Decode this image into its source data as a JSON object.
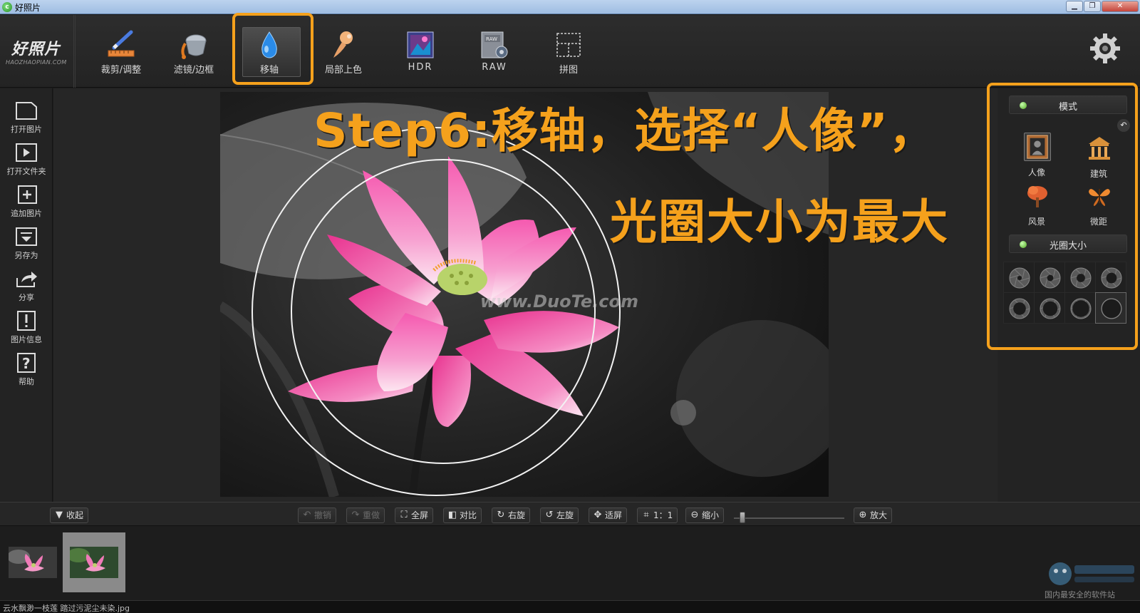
{
  "window": {
    "title": "好照片",
    "app_icon": "green-leaf-icon",
    "controls": [
      "minimize",
      "maximize",
      "close"
    ]
  },
  "logo": {
    "main": "好照片",
    "sub": "HAOZHAOPIAN.COM"
  },
  "toolbar": {
    "tools": [
      {
        "label": "裁剪/调整",
        "icon": "crop-ruler-icon"
      },
      {
        "label": "滤镜/边框",
        "icon": "paint-bucket-icon"
      },
      {
        "label": "移轴",
        "icon": "water-drop-icon",
        "selected": true
      },
      {
        "label": "局部上色",
        "icon": "paint-brush-icon"
      },
      {
        "label": "HDR",
        "icon": "hdr-image-icon"
      },
      {
        "label": "RAW",
        "icon": "raw-file-icon"
      },
      {
        "label": "拼图",
        "icon": "collage-grid-icon"
      }
    ],
    "settings_icon": "gear-icon"
  },
  "sidebar": {
    "items": [
      {
        "label": "打开图片",
        "icon": "open-image-icon"
      },
      {
        "label": "打开文件夹",
        "icon": "open-folder-icon"
      },
      {
        "label": "追加图片",
        "icon": "add-image-icon"
      },
      {
        "label": "另存为",
        "icon": "save-as-icon"
      },
      {
        "label": "分享",
        "icon": "share-icon"
      },
      {
        "label": "图片信息",
        "icon": "image-info-icon"
      },
      {
        "label": "帮助",
        "icon": "help-icon"
      }
    ]
  },
  "annotation": {
    "line1": "Step6:移轴，选择“人像”，",
    "line2": "光圈大小为最大",
    "color": "#f5a11c"
  },
  "photo": {
    "watermark": "www.DuoTe.com"
  },
  "right_panel": {
    "mode_header": "模式",
    "modes": [
      {
        "label": "人像",
        "icon": "portrait-frame-icon",
        "selected": true
      },
      {
        "label": "建筑",
        "icon": "building-icon"
      },
      {
        "label": "风景",
        "icon": "tree-icon"
      },
      {
        "label": "微距",
        "icon": "butterfly-icon"
      }
    ],
    "aperture_header": "光圈大小",
    "aperture_count": 8,
    "aperture_selected_index": 7,
    "back_icon": "back-arrow-icon"
  },
  "controls": {
    "collapse": "收起",
    "undo": "撤销",
    "redo": "重做",
    "fullscreen": "全屏",
    "compare": "对比",
    "rotate_right": "右旋",
    "rotate_left": "左旋",
    "fit_screen": "适屏",
    "actual_size": "1：1",
    "zoom_out": "缩小",
    "zoom_in": "放大"
  },
  "filmstrip": {
    "thumbnails": [
      {
        "name": "lotus-bw-thumbnail",
        "selected": false
      },
      {
        "name": "lotus-color-thumbnail",
        "selected": true
      }
    ]
  },
  "site_watermark": {
    "text": "国内最安全的软件站",
    "logo": "2345-logo"
  },
  "status": {
    "filename": "云水飘渺一枝莲 踏过污泥尘未染.jpg"
  },
  "colors": {
    "accent": "#f5a11c",
    "background": "#1c1c1c",
    "panel": "#232323"
  }
}
